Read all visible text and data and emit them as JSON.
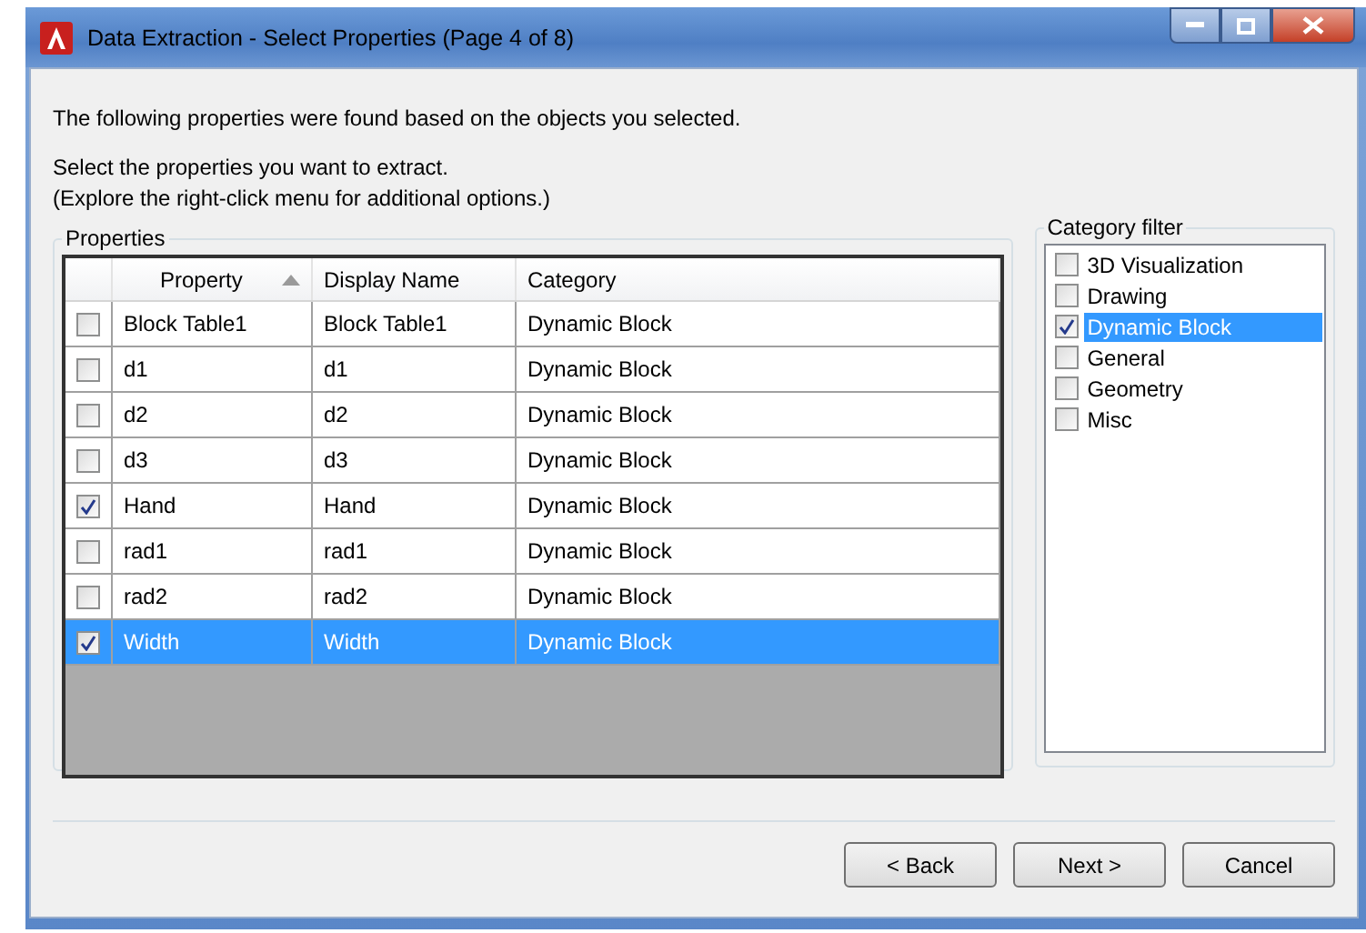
{
  "window": {
    "title": "Data Extraction - Select Properties (Page 4 of 8)"
  },
  "intro": "The following properties were found based on the objects you selected.",
  "instructions": [
    "Select the properties you want to extract.",
    "(Explore the right-click menu for additional options.)"
  ],
  "properties": {
    "label": "Properties",
    "columns": [
      {
        "label": "Property",
        "sorted": true
      },
      {
        "label": "Display Name",
        "sorted": false
      },
      {
        "label": "Category",
        "sorted": false
      }
    ],
    "rows": [
      {
        "property": "Block Table1",
        "display_name": "Block Table1",
        "category": "Dynamic Block",
        "checked": false,
        "selected": false
      },
      {
        "property": "d1",
        "display_name": "d1",
        "category": "Dynamic Block",
        "checked": false,
        "selected": false
      },
      {
        "property": "d2",
        "display_name": "d2",
        "category": "Dynamic Block",
        "checked": false,
        "selected": false
      },
      {
        "property": "d3",
        "display_name": "d3",
        "category": "Dynamic Block",
        "checked": false,
        "selected": false
      },
      {
        "property": "Hand",
        "display_name": "Hand",
        "category": "Dynamic Block",
        "checked": true,
        "selected": false
      },
      {
        "property": "rad1",
        "display_name": "rad1",
        "category": "Dynamic Block",
        "checked": false,
        "selected": false
      },
      {
        "property": "rad2",
        "display_name": "rad2",
        "category": "Dynamic Block",
        "checked": false,
        "selected": false
      },
      {
        "property": "Width",
        "display_name": "Width",
        "category": "Dynamic Block",
        "checked": true,
        "selected": true
      }
    ]
  },
  "category_filter": {
    "label": "Category filter",
    "items": [
      {
        "label": "3D Visualization",
        "checked": false,
        "selected": false
      },
      {
        "label": "Drawing",
        "checked": false,
        "selected": false
      },
      {
        "label": "Dynamic Block",
        "checked": true,
        "selected": true
      },
      {
        "label": "General",
        "checked": false,
        "selected": false
      },
      {
        "label": "Geometry",
        "checked": false,
        "selected": false
      },
      {
        "label": "Misc",
        "checked": false,
        "selected": false
      }
    ]
  },
  "buttons": [
    "< Back",
    "Next >",
    "Cancel"
  ]
}
